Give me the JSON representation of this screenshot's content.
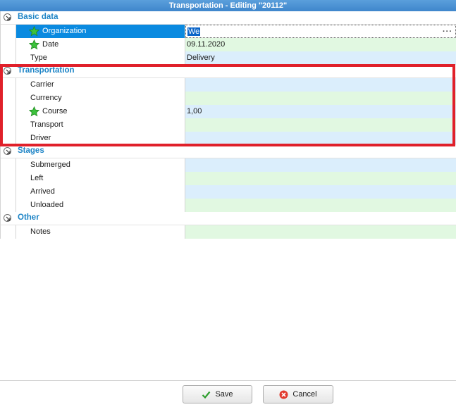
{
  "window": {
    "title": "Transportation - Editing \"20112\""
  },
  "sections": {
    "basic": {
      "title": "Basic data",
      "rows": [
        {
          "label": "Organization",
          "value": "We"
        },
        {
          "label": "Date",
          "value": "09.11.2020"
        },
        {
          "label": "Type",
          "value": "Delivery"
        }
      ]
    },
    "transportation": {
      "title": "Transportation",
      "rows": [
        {
          "label": "Carrier",
          "value": ""
        },
        {
          "label": "Currency",
          "value": ""
        },
        {
          "label": "Course",
          "value": "1,00"
        },
        {
          "label": "Transport",
          "value": ""
        },
        {
          "label": "Driver",
          "value": ""
        }
      ]
    },
    "stages": {
      "title": "Stages",
      "rows": [
        {
          "label": "Submerged",
          "value": ""
        },
        {
          "label": "Left",
          "value": ""
        },
        {
          "label": "Arrived",
          "value": ""
        },
        {
          "label": "Unloaded",
          "value": ""
        }
      ]
    },
    "other": {
      "title": "Other",
      "rows": [
        {
          "label": "Notes",
          "value": ""
        }
      ]
    }
  },
  "buttons": {
    "save": "Save",
    "cancel": "Cancel"
  },
  "icons": {
    "star": "star-icon",
    "collapse": "collapse-arrow-icon",
    "ellipsis": "ellipsis-icon",
    "save": "checkmark-icon",
    "cancel": "cancel-icon"
  },
  "colors": {
    "title_bar": "#3f86cc",
    "section_title": "#1d84c6",
    "selected_row": "#0a8ae0",
    "value_blue": "#dbeefc",
    "value_green": "#e1f8e1",
    "highlight": "#e0202a"
  }
}
